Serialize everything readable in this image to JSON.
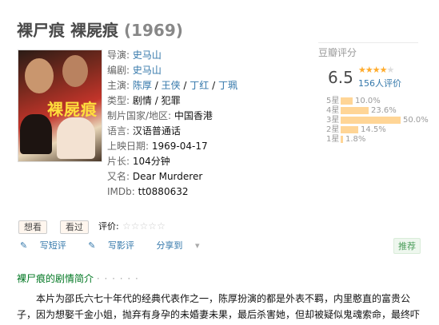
{
  "title": "裸尸痕 裸屍痕",
  "year": "(1969)",
  "poster": {
    "text": "裸屍痕"
  },
  "info": {
    "director_label": "导演:",
    "director": "史马山",
    "writer_label": "编剧:",
    "writer": "史马山",
    "cast_label": "主演:",
    "cast": [
      "陈厚",
      "王侠",
      "丁红",
      "丁珮"
    ],
    "genre_label": "类型:",
    "genre": [
      "剧情",
      "犯罪"
    ],
    "country_label": "制片国家/地区:",
    "country": "中国香港",
    "language_label": "语言:",
    "language": "汉语普通话",
    "release_label": "上映日期:",
    "release": "1969-04-17",
    "runtime_label": "片长:",
    "runtime": "104分钟",
    "aka_label": "又名:",
    "aka": "Dear Murderer",
    "imdb_label": "IMDb:",
    "imdb": "tt0880632"
  },
  "rating": {
    "title": "豆瓣评分",
    "score": "6.5",
    "stars_filled": 3.5,
    "count_text": "156人评价",
    "bars": [
      {
        "label": "5星",
        "percent": 10.0,
        "text": "10.0%"
      },
      {
        "label": "4星",
        "percent": 23.6,
        "text": "23.6%"
      },
      {
        "label": "3星",
        "percent": 50.0,
        "text": "50.0%"
      },
      {
        "label": "2星",
        "percent": 14.5,
        "text": "14.5%"
      },
      {
        "label": "1星",
        "percent": 1.8,
        "text": "1.8%"
      }
    ]
  },
  "actions": {
    "want": "想看",
    "seen": "看过",
    "rate_label": "评价:",
    "short_review": "写短评",
    "review": "写影评",
    "share": "分享到",
    "recommend": "推荐"
  },
  "synopsis": {
    "title": "裸尸痕的剧情简介",
    "dots": "· · · · · ·",
    "text": "本片为邵氏六七十年代的经典代表作之一，陈厚扮演的都是外表不羁，内里憨直的富贵公子，因为想娶千金小姐，抛弃有身孕的未婚妻未果，最后杀害她，但却被疑似鬼魂索命，最终吓"
  },
  "colors": {
    "link": "#3377aa",
    "star": "#ffac2d",
    "bar": "#ffd596",
    "green": "#007722"
  }
}
